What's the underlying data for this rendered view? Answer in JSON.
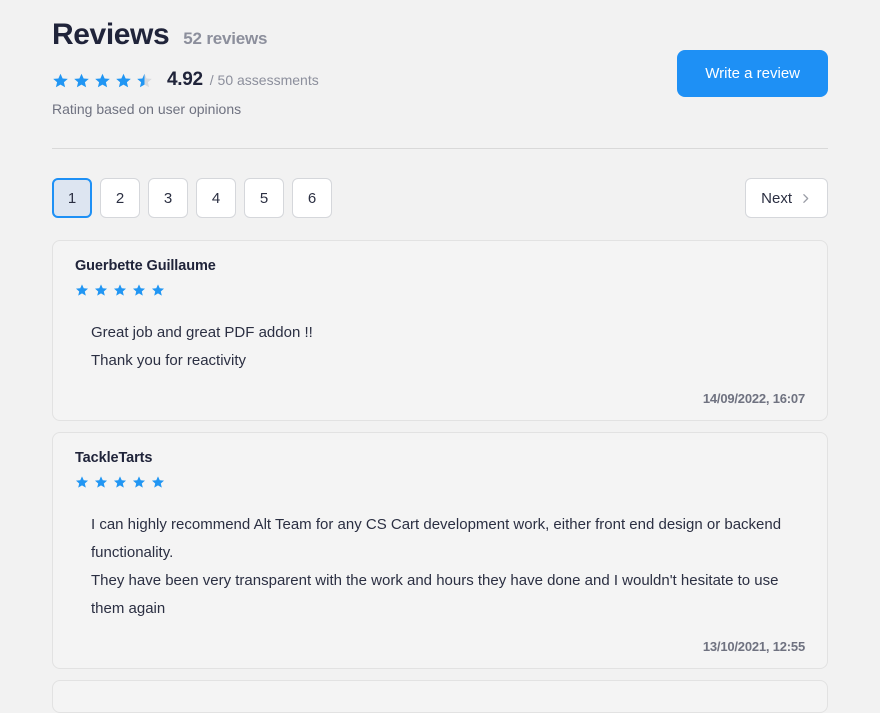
{
  "header": {
    "title": "Reviews",
    "reviews_count_label": "52 reviews",
    "score": "4.92",
    "score_sub": "/ 50 assessments",
    "rating_note": "Rating based on user opinions",
    "write_review_label": "Write a review",
    "overall_stars": {
      "full": 4,
      "half": 1,
      "empty": 0,
      "icon": "star-icon"
    }
  },
  "colors": {
    "accent": "#1e90f5",
    "star_filled": "#2196f3",
    "star_empty": "#d8dade",
    "page_bg": "#f2f2f2",
    "card_bg": "#f4f4f4",
    "card_border": "#e2e2e2",
    "text_dark": "#20243a",
    "text_muted": "#8c8f9c",
    "active_page_bg": "#dde5f1"
  },
  "pagination": {
    "pages": [
      "1",
      "2",
      "3",
      "4",
      "5",
      "6"
    ],
    "active_page": "1",
    "next_label": "Next",
    "next_icon": "chevron-right-icon"
  },
  "reviews": [
    {
      "author": "Guerbette Guillaume",
      "stars": 5,
      "paragraphs": [
        "Great job and great PDF addon !!",
        "Thank you for reactivity"
      ],
      "date": "14/09/2022, 16:07"
    },
    {
      "author": "TackleTarts",
      "stars": 5,
      "paragraphs": [
        "I can highly recommend Alt Team for any CS Cart development work, either front end design or backend functionality.",
        "They have been very transparent with the work and hours they have done and I wouldn't hesitate to use them again"
      ],
      "date": "13/10/2021, 12:55"
    },
    {
      "author": "",
      "stars": 0,
      "paragraphs": [],
      "date": ""
    }
  ]
}
